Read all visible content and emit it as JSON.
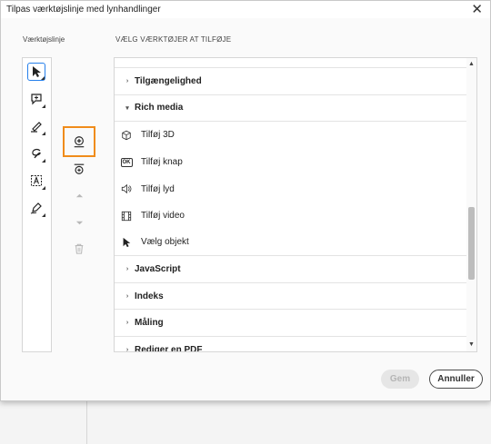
{
  "window": {
    "title": "Tilpas værktøjslinje med lynhandlinger",
    "close_icon": "close-icon"
  },
  "left": {
    "label": "Værktøjslinje",
    "tools": [
      {
        "icon": "select-pointer-icon",
        "selected": true
      },
      {
        "icon": "add-comment-icon",
        "selected": false
      },
      {
        "icon": "highlight-pen-icon",
        "selected": false
      },
      {
        "icon": "draw-lasso-icon",
        "selected": false
      },
      {
        "icon": "text-box-icon",
        "selected": false
      },
      {
        "icon": "sign-pen-icon",
        "selected": false
      }
    ]
  },
  "middle": {
    "buttons": [
      {
        "icon": "add-tool-icon",
        "highlighted": true
      },
      {
        "icon": "add-divider-icon"
      },
      {
        "icon": "move-up-icon",
        "disabled": true
      },
      {
        "icon": "move-down-icon",
        "disabled": true
      },
      {
        "icon": "delete-icon",
        "disabled": true
      }
    ],
    "highlight_color": "#f08c1b"
  },
  "right": {
    "label": "VÆLG VÆRKTØJER AT TILFØJE",
    "rows": [
      {
        "type": "category",
        "label": "Tilgængelighed",
        "expanded": false
      },
      {
        "type": "category",
        "label": "Rich media",
        "expanded": true
      },
      {
        "type": "item",
        "label": "Tilføj 3D",
        "icon": "cube-3d-icon"
      },
      {
        "type": "item",
        "label": "Tilføj knap",
        "icon": "ok-button-icon"
      },
      {
        "type": "item",
        "label": "Tilføj lyd",
        "icon": "speaker-icon"
      },
      {
        "type": "item",
        "label": "Tilføj video",
        "icon": "film-icon"
      },
      {
        "type": "item",
        "label": "Vælg objekt",
        "icon": "pointer-icon"
      },
      {
        "type": "category",
        "label": "JavaScript",
        "expanded": false
      },
      {
        "type": "category",
        "label": "Indeks",
        "expanded": false
      },
      {
        "type": "category",
        "label": "Måling",
        "expanded": false
      },
      {
        "type": "category",
        "label": "Rediger en PDF",
        "expanded": false
      }
    ],
    "ok_icon_text": "OK",
    "chev_collapsed": "›",
    "chev_expanded": "▾"
  },
  "footer": {
    "save_label": "Gem",
    "cancel_label": "Annuller"
  },
  "colors": {
    "accent": "#2680eb",
    "highlight": "#f08c1b"
  }
}
